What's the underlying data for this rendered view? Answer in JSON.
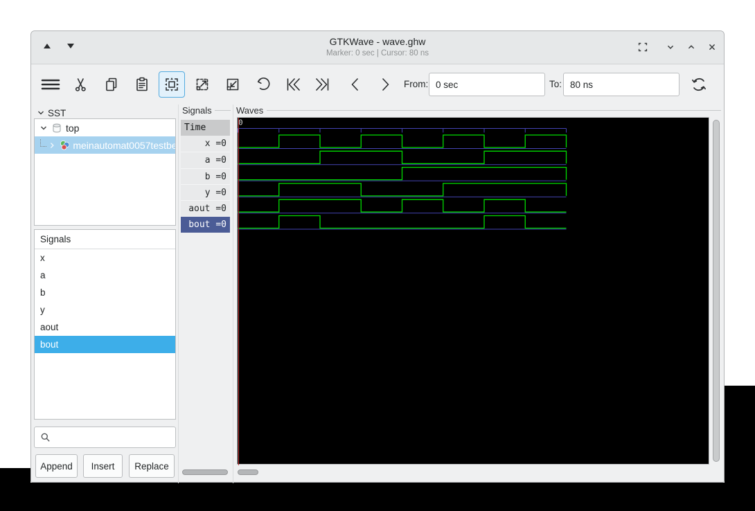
{
  "titlebar": {
    "title": "GTKWave - wave.ghw",
    "subtitle": "Marker: 0 sec  |  Cursor: 80 ns"
  },
  "toolbar": {
    "from_label": "From:",
    "from_value": "0 sec",
    "to_label": "To:",
    "to_value": "80 ns"
  },
  "sidebar": {
    "sst_label": "SST",
    "tree": {
      "root": "top",
      "child": "meinautomat0057testbe"
    },
    "signals_header": "Signals",
    "items": [
      "x",
      "a",
      "b",
      "y",
      "aout",
      "bout"
    ],
    "selected_item": "bout",
    "buttons": {
      "append": "Append",
      "insert": "Insert",
      "replace": "Replace"
    }
  },
  "signals_panel": {
    "frame_label": "Signals",
    "time_header": "Time",
    "rows": [
      "x =0",
      "a =0",
      "b =0",
      "y =0",
      "aout =0",
      "bout =0"
    ],
    "selected_row": "bout =0"
  },
  "waves_panel": {
    "frame_label": "Waves",
    "origin_label": "0"
  },
  "chart_data": {
    "type": "line",
    "title": "GTKWave digital waveforms",
    "x_unit": "ns",
    "x_range": [
      0,
      80
    ],
    "tick_interval_ns": 10,
    "marker_time": "0 sec",
    "cursor_time": "80 ns",
    "series": [
      {
        "name": "x",
        "segments": [
          [
            0,
            10,
            0
          ],
          [
            10,
            20,
            1
          ],
          [
            20,
            30,
            0
          ],
          [
            30,
            40,
            1
          ],
          [
            40,
            50,
            0
          ],
          [
            50,
            60,
            1
          ],
          [
            60,
            70,
            0
          ],
          [
            70,
            80,
            1
          ]
        ]
      },
      {
        "name": "a",
        "segments": [
          [
            0,
            20,
            0
          ],
          [
            20,
            40,
            1
          ],
          [
            40,
            60,
            0
          ],
          [
            60,
            80,
            1
          ]
        ]
      },
      {
        "name": "b",
        "segments": [
          [
            0,
            40,
            0
          ],
          [
            40,
            80,
            1
          ]
        ]
      },
      {
        "name": "y",
        "segments": [
          [
            0,
            10,
            0
          ],
          [
            10,
            30,
            1
          ],
          [
            30,
            50,
            0
          ],
          [
            50,
            80,
            1
          ]
        ]
      },
      {
        "name": "aout",
        "segments": [
          [
            0,
            10,
            0
          ],
          [
            10,
            30,
            1
          ],
          [
            30,
            40,
            0
          ],
          [
            40,
            50,
            1
          ],
          [
            50,
            60,
            0
          ],
          [
            60,
            70,
            1
          ],
          [
            70,
            80,
            0
          ]
        ]
      },
      {
        "name": "bout",
        "segments": [
          [
            0,
            10,
            0
          ],
          [
            10,
            20,
            1
          ],
          [
            20,
            60,
            0
          ],
          [
            60,
            70,
            1
          ],
          [
            70,
            80,
            0
          ]
        ]
      }
    ],
    "colors": {
      "trace": "#00dc00",
      "grid": "#4444b4",
      "marker": "#c23636",
      "background": "#000000"
    }
  }
}
